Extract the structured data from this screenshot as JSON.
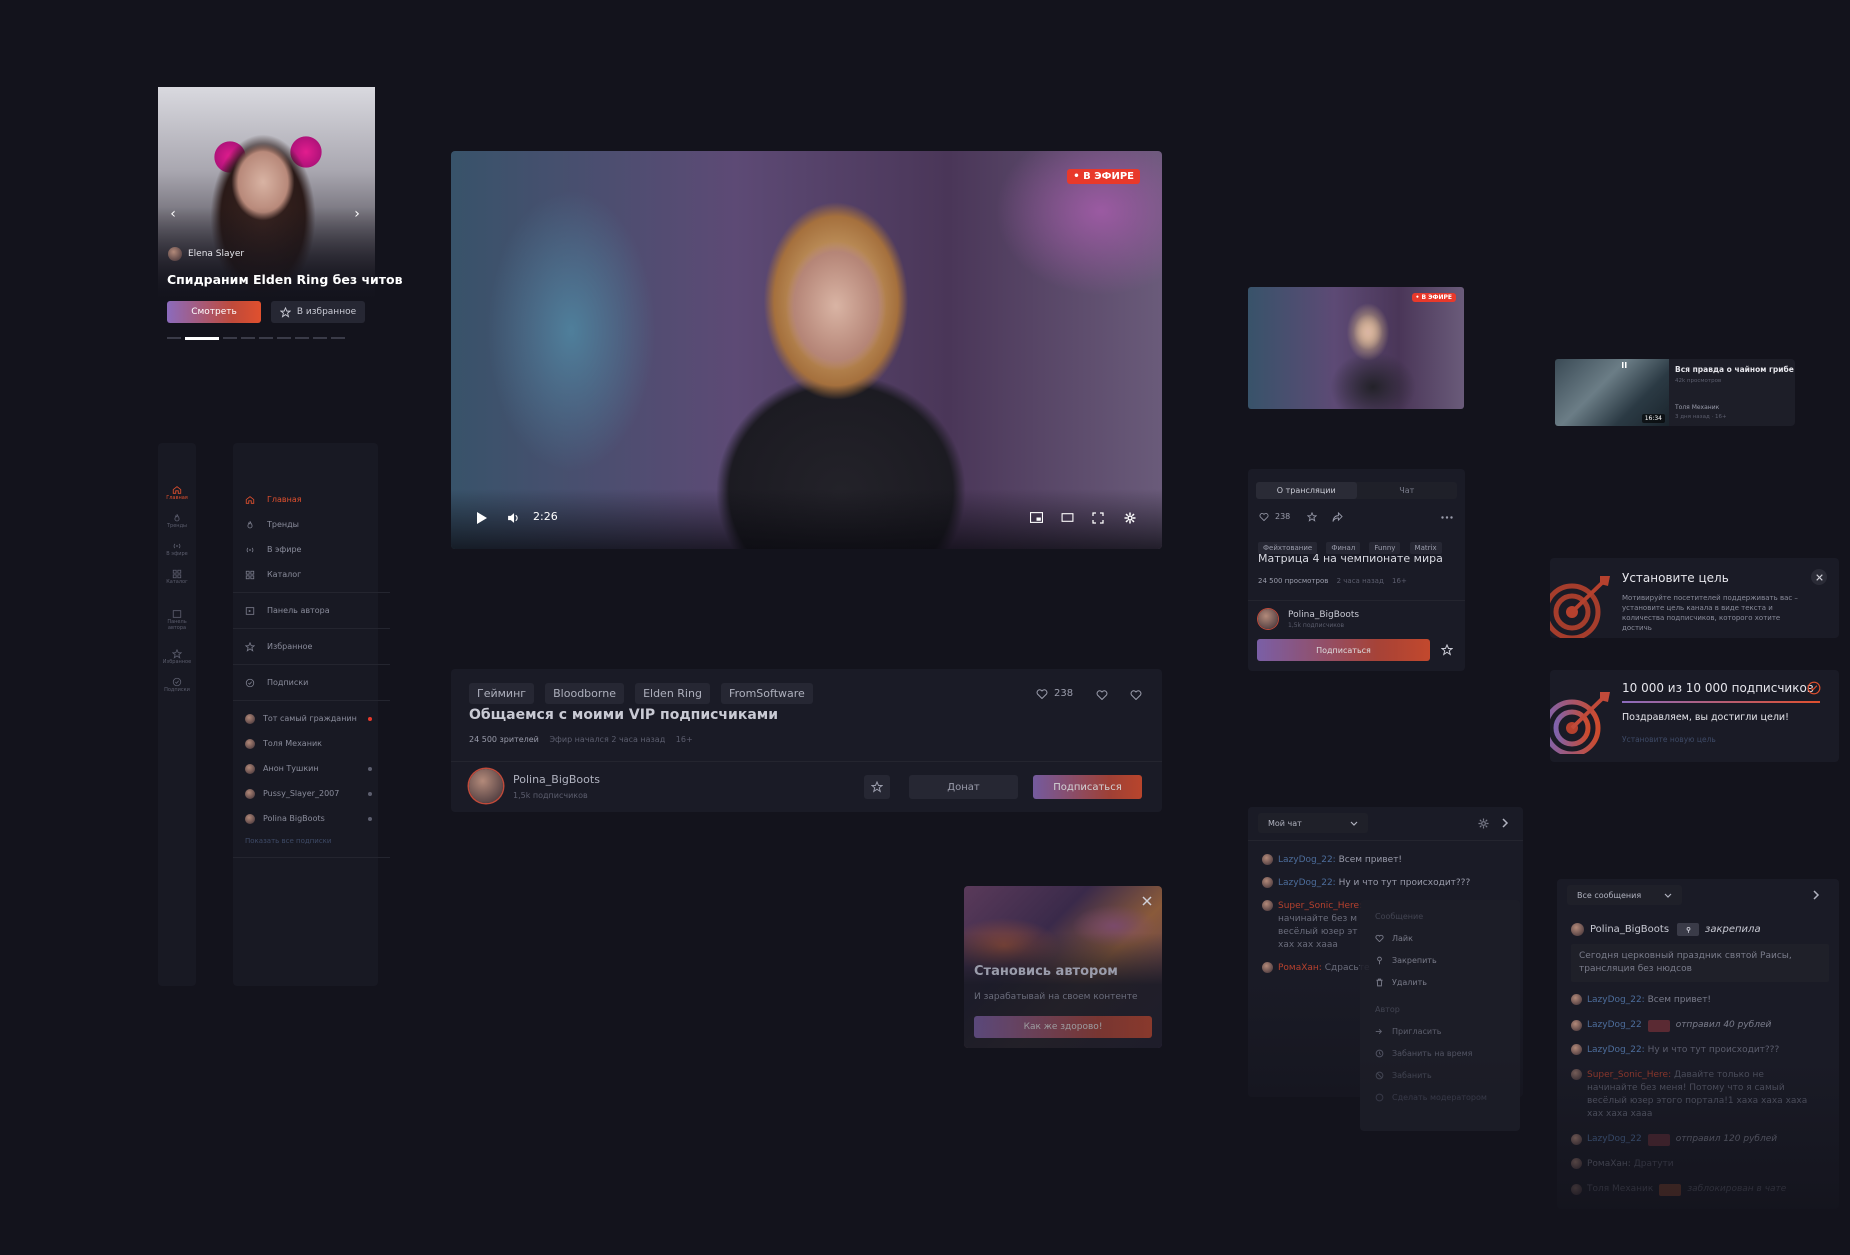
{
  "banner": {
    "streamer": "Elena Slayer",
    "title": "Спидраним Elden Ring без читов",
    "watch_label": "Смотреть",
    "fav_label": "В избранное"
  },
  "rail": {
    "items": [
      {
        "label": "Главная"
      },
      {
        "label": "Тренды"
      },
      {
        "label": "В эфире"
      },
      {
        "label": "Каталог"
      },
      {
        "label": "Панель автора"
      },
      {
        "label": "Избранное"
      },
      {
        "label": "Подписки"
      }
    ]
  },
  "sidebar": {
    "nav": [
      {
        "label": "Главная"
      },
      {
        "label": "Тренды"
      },
      {
        "label": "В эфире"
      },
      {
        "label": "Каталог"
      }
    ],
    "author_panel": "Панель автора",
    "favorites": "Избранное",
    "subscriptions": "Подписки",
    "subs": [
      {
        "name": "Тот самый гражданин"
      },
      {
        "name": "Толя Механик"
      },
      {
        "name": "Анон Тушкин"
      },
      {
        "name": "Pussy_Slayer_2007"
      },
      {
        "name": "Polina BigBoots"
      }
    ],
    "show_all": "Показать все подписки"
  },
  "player": {
    "live_label": "• В ЭФИРЕ",
    "time": "2:26"
  },
  "stream_info": {
    "tags": [
      "Гейминг",
      "Bloodborne",
      "Elden Ring",
      "FromSoftware"
    ],
    "likes": "238",
    "title": "Общаемся с моими VIP подписчиками",
    "viewers": "24 500 зрителей",
    "started": "Эфир начался 2 часа назад",
    "age": "16+",
    "channel": "Polina_BigBoots",
    "channel_subs": "1,5k подписчиков",
    "donate_label": "Донат",
    "subscribe_label": "Подписаться"
  },
  "creator_promo": {
    "title": "Становись автором",
    "subtitle": "И зарабатывай на своем контенте",
    "cta": "Как же здорово!"
  },
  "mini_player": {
    "live_label": "• В ЭФИРЕ"
  },
  "about_panel": {
    "tab_about": "О трансляции",
    "tab_chat": "Чат",
    "likes": "238",
    "tags": [
      "Фейхтование",
      "Финал",
      "Funny",
      "Matrix"
    ],
    "title": "Матрица 4 на чемпионате мира",
    "views": "24 500 просмотров",
    "when": "2 часа назад",
    "age": "16+",
    "channel": "Polina_BigBoots",
    "channel_subs": "1,5k подписчиков",
    "subscribe_label": "Подписаться"
  },
  "video_card": {
    "title": "Вся правда о чайном грибе",
    "views": "42k просмотров",
    "author": "Толя Механик",
    "meta": "3 дня назад · 16+",
    "duration": "16:34"
  },
  "goal_card": {
    "title": "Установите цель",
    "text": "Мотивируйте посетителей поддерживать вас – установите цель канала в виде текста и количества подписчиков, которого хотите достичь"
  },
  "goal_done": {
    "title": "10 000 из 10 000 подписчиков",
    "congrats": "Поздравляем, вы достигли цели!",
    "new_goal": "Установите новую цель",
    "progress": 1.0
  },
  "chat": {
    "selector": "Мой чат",
    "messages": [
      {
        "nick": "LazyDog_22:",
        "text": "Всем привет!",
        "color": "blue"
      },
      {
        "nick": "LazyDog_22:",
        "text": "Ну и что тут происходит???",
        "color": "blue"
      },
      {
        "nick": "Super_Sonic_Here:",
        "text": "Давайте только не начинайте без меня! Потому что я самый весёлый юзер этого портала! хаха хаха хах хаха хааа",
        "color": "red"
      },
      {
        "nick": "РомаХан:",
        "text": "Сдрасьте",
        "color": "red"
      }
    ],
    "visible_lines": [
      {
        "nick": "LazyDog_22:",
        "text": "Всем привет!"
      },
      {
        "nick": "LazyDog_22:",
        "text": "Ну и что тут происходит???"
      },
      {
        "nick": "Super_Sonic_Here:",
        "l1": "Давайте только не",
        "l2": "начинайте без м",
        "l3": "весёлый юзер эт",
        "l4": "хах хах хааа"
      },
      {
        "nick": "РомаХан:",
        "text": "Сдрасьте"
      }
    ],
    "menu": {
      "section_message": "Сообщение",
      "like": "Лайк",
      "pin": "Закрепить",
      "delete": "Удалить",
      "section_author": "Автор",
      "invite": "Пригласить",
      "ban_temp": "Забанить на время",
      "ban": "Забанить",
      "make_mod": "Сделать модератором"
    }
  },
  "chat2": {
    "selector": "Все сообщения",
    "pinned_author": "Polina_BigBoots",
    "pinned_label": "закрепила",
    "pinned_text": "Сегодня церковный праздник святой Раисы, трансляция без нюдсов",
    "messages": [
      {
        "nick": "LazyDog_22:",
        "text": "Всем привет!"
      },
      {
        "nick": "LazyDog_22",
        "donation": "отправил 40 рублей"
      },
      {
        "nick": "LazyDog_22:",
        "text": "Ну и что тут происходит???"
      },
      {
        "nick": "Super_Sonic_Here:",
        "text": "Давайте только не начинайте без меня! Потому что я самый весёлый юзер этого портала!1 хаха хаха хаха хах хаха хааа"
      },
      {
        "nick": "LazyDog_22",
        "donation": "отправил 120 рублей"
      },
      {
        "nick": "РомаХан:",
        "text": "Дратути"
      },
      {
        "nick": "Толя Механик",
        "donation": "заблокирован в чате"
      }
    ]
  },
  "colors": {
    "bg": "#13131c",
    "panel": "#1a1b26",
    "accent": "#e0502e",
    "accent_purple": "#8b6bbd",
    "live": "#e8392b"
  }
}
